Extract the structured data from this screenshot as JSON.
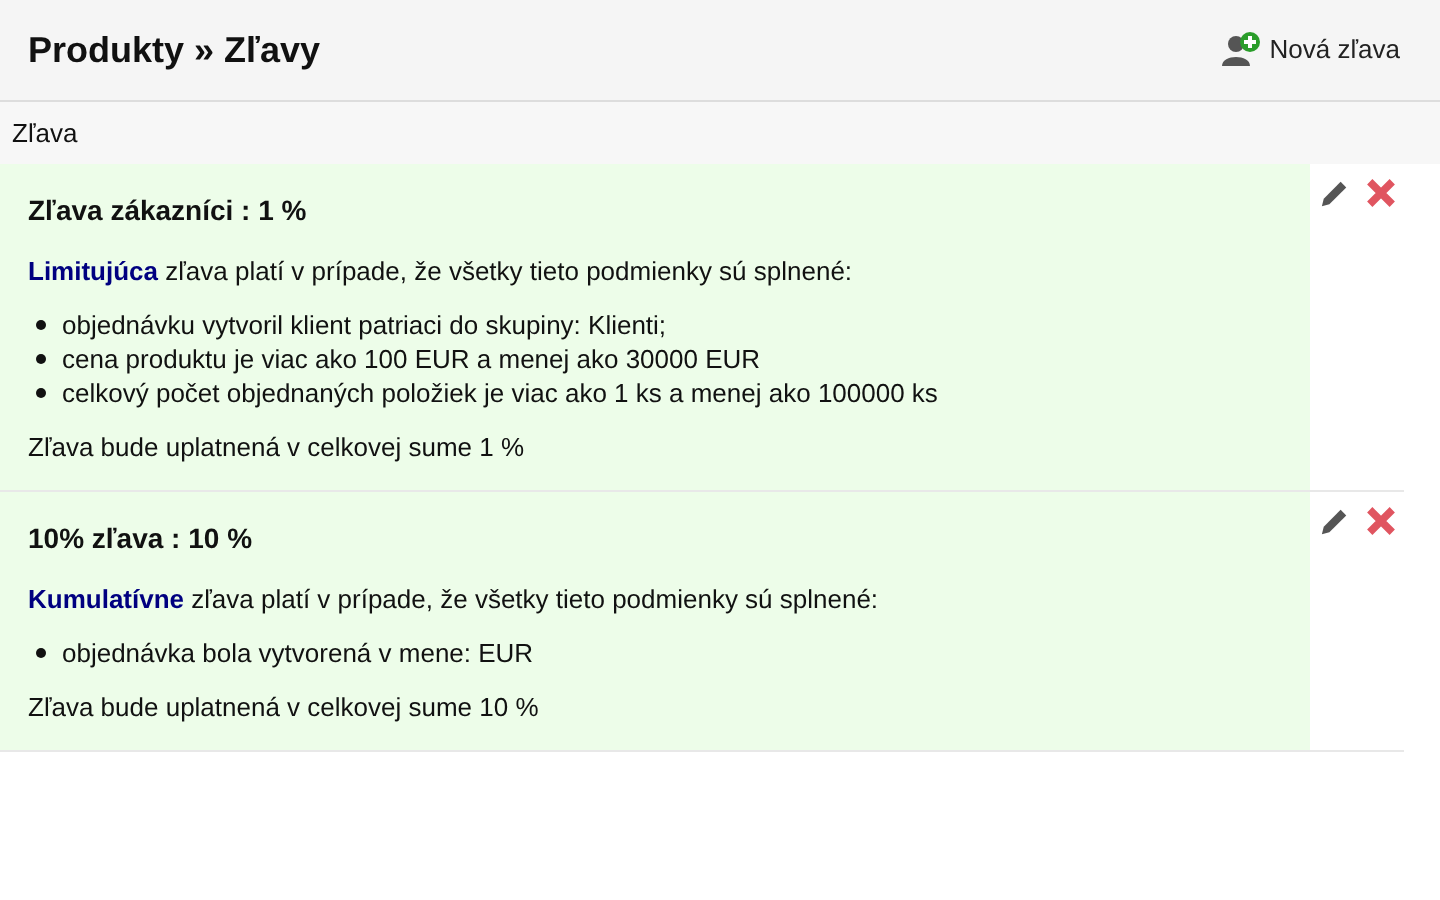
{
  "header": {
    "title": "Produkty » Zľavy",
    "new_button": "Nová zľava"
  },
  "table": {
    "column": "Zľava",
    "rows": [
      {
        "title": "Zľava zákazníci : 1 %",
        "description": "**Limitujúca** zľava platí v prípade, že všetky tieto podmienky sú splnené:",
        "conditions": [
          "objednávku vytvoril klient patriaci do skupiny: Klienti;",
          "cena produktu je viac ako 100 EUR a menej ako 30000 EUR",
          "celkový počet objednaných položiek je viac ako 1 ks a menej ako 100000 ks"
        ],
        "summary": "Zľava bude uplatnená v celkovej sume 1 %"
      },
      {
        "title": "10% zľava : 10 %",
        "description": "**Kumulatívne** zľava platí v prípade, že všetky tieto podmienky sú splnené:",
        "conditions": [
          "objednávka bola vytvorená v mene: EUR"
        ],
        "summary": "Zľava bude uplatnená v celkovej sume 10 %"
      }
    ]
  }
}
